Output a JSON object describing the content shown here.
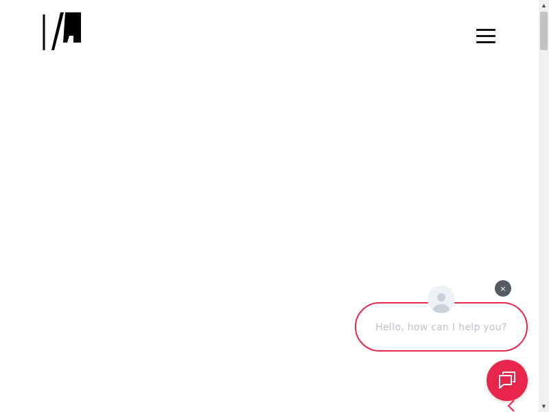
{
  "header": {
    "logo_icon": "brand-logo-icon",
    "menu_icon": "hamburger-menu-icon"
  },
  "chat": {
    "greeting": "Hello, how can I help you?",
    "close_glyph": "×",
    "accent_color": "#e8254a",
    "avatar_icon": "user-avatar-icon",
    "launcher_icon": "chat-icon",
    "prev_icon": "chevron-left-icon"
  },
  "scrollbar": {
    "up_glyph": "▲",
    "down_glyph": "▼"
  }
}
